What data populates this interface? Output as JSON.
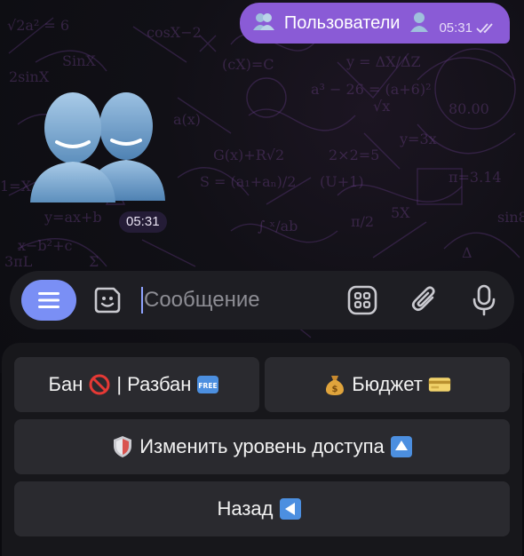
{
  "chat": {
    "outgoing_message": {
      "text": "Пользователи",
      "time": "05:31",
      "status": "double-check-read"
    },
    "sticker": {
      "emoji": "busts-in-silhouette",
      "time": "05:31"
    }
  },
  "input_bar": {
    "placeholder": "Сообщение",
    "menu_icon": "hamburger-menu-icon",
    "sticker_icon": "sticker-icon",
    "keyboard_icon": "bot-keyboard-icon",
    "attach_icon": "paperclip-icon",
    "mic_icon": "microphone-icon"
  },
  "keyboard": {
    "rows": [
      [
        {
          "pre": "Бан",
          "mid": "| Разбан",
          "emoji": [
            "prohibited-icon",
            "free-icon"
          ]
        },
        {
          "label": "Бюджет",
          "emoji": [
            "money-bag-icon",
            "credit-card-icon"
          ]
        }
      ],
      [
        {
          "label": "Изменить уровень доступа",
          "emoji": [
            "shield-icon",
            "up-button-icon"
          ]
        }
      ],
      [
        {
          "label": "Назад",
          "emoji": [
            "reverse-button-icon"
          ]
        }
      ]
    ]
  },
  "colors": {
    "bubble": "#8a5bd6",
    "menu_button": "#7a8ff5",
    "keyboard_button": "#2a2a2f",
    "input_bar": "#1e1e23"
  }
}
